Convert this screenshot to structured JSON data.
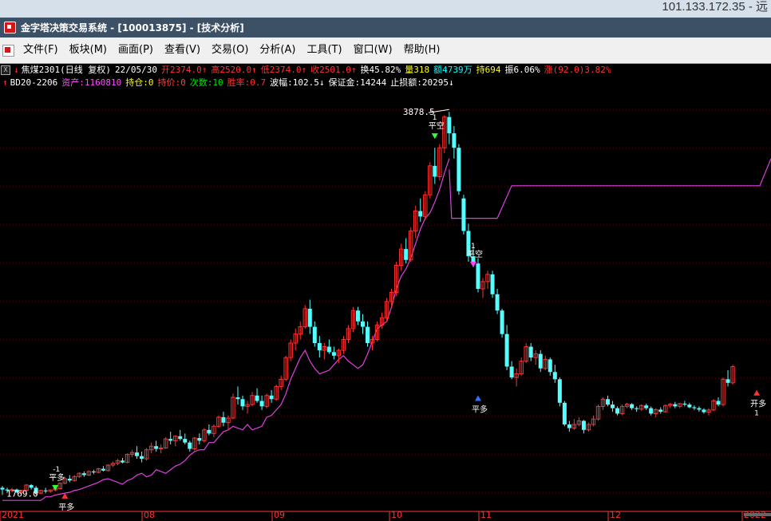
{
  "system": {
    "ip": "101.133.172.35 - 远"
  },
  "title": {
    "text": "金字塔决策交易系统 - [100013875] - [技术分析]"
  },
  "menu": {
    "items": [
      {
        "label": "文件(F)"
      },
      {
        "label": "板块(M)"
      },
      {
        "label": "画面(P)"
      },
      {
        "label": "查看(V)"
      },
      {
        "label": "交易(O)"
      },
      {
        "label": "分析(A)"
      },
      {
        "label": "工具(T)"
      },
      {
        "label": "窗口(W)"
      },
      {
        "label": "帮助(H)"
      }
    ]
  },
  "quote": {
    "symbol": "焦煤2301(日线 复权)",
    "date": "22/05/30",
    "open": "开2374.0",
    "high": "高2520.0",
    "low": "低2374.0",
    "close": "收2501.0",
    "turnover": "换45.82%",
    "volume": "量318",
    "amount": "额4739万",
    "oi": "持694",
    "amplitude": "振6.06%",
    "change": "涨(92.0)3.82%"
  },
  "strategy": {
    "name": "BD20-2206",
    "assets": "资产:1160810",
    "position": "持仓:0",
    "avg_price": "持价:0",
    "trades": "次数:10",
    "win_rate": "胜率:0.7",
    "swing": "波幅:102.5",
    "margin": "保证金:14244",
    "stop": "止损额:20295"
  },
  "annotations": {
    "high_label": "3878.5",
    "low_label": "1769.0"
  },
  "signals": [
    {
      "label": "平多",
      "sub": "-1"
    },
    {
      "label": "平多",
      "sub": ""
    },
    {
      "label": "平空",
      "sub": "1"
    },
    {
      "label": "开多",
      "sub": "1"
    },
    {
      "label": "平空",
      "sub": "1"
    },
    {
      "label": "平多",
      "sub": ""
    }
  ],
  "chart_data": {
    "type": "candlestick",
    "x_ticks": [
      "2021",
      "08",
      "09",
      "10",
      "11",
      "12",
      "2022"
    ],
    "candles": [
      [
        1800,
        1810,
        1760,
        1790
      ],
      [
        1790,
        1800,
        1770,
        1785
      ],
      [
        1785,
        1800,
        1775,
        1790
      ],
      [
        1790,
        1795,
        1770,
        1775
      ],
      [
        1775,
        1790,
        1765,
        1785
      ],
      [
        1785,
        1820,
        1780,
        1815
      ],
      [
        1815,
        1820,
        1790,
        1800
      ],
      [
        1800,
        1810,
        1760,
        1770
      ],
      [
        1770,
        1790,
        1765,
        1785
      ],
      [
        1785,
        1800,
        1770,
        1780
      ],
      [
        1780,
        1790,
        1772,
        1788
      ],
      [
        1788,
        1800,
        1780,
        1795
      ],
      [
        1795,
        1830,
        1790,
        1825
      ],
      [
        1825,
        1860,
        1820,
        1850
      ],
      [
        1850,
        1870,
        1830,
        1840
      ],
      [
        1840,
        1870,
        1835,
        1862
      ],
      [
        1862,
        1885,
        1855,
        1880
      ],
      [
        1880,
        1890,
        1860,
        1870
      ],
      [
        1870,
        1895,
        1865,
        1890
      ],
      [
        1890,
        1900,
        1875,
        1885
      ],
      [
        1885,
        1910,
        1880,
        1905
      ],
      [
        1905,
        1920,
        1890,
        1895
      ],
      [
        1895,
        1930,
        1890,
        1925
      ],
      [
        1925,
        1945,
        1915,
        1935
      ],
      [
        1935,
        1960,
        1925,
        1950
      ],
      [
        1950,
        1965,
        1935,
        1940
      ],
      [
        1940,
        1990,
        1935,
        1985
      ],
      [
        1985,
        2010,
        1970,
        1995
      ],
      [
        1995,
        2030,
        1960,
        1975
      ],
      [
        1975,
        2000,
        1940,
        1960
      ],
      [
        1960,
        2020,
        1950,
        2010
      ],
      [
        2010,
        2050,
        1990,
        2030
      ],
      [
        2030,
        2060,
        2000,
        2015
      ],
      [
        2015,
        2040,
        1990,
        2020
      ],
      [
        2020,
        2080,
        2015,
        2070
      ],
      [
        2070,
        2110,
        2040,
        2060
      ],
      [
        2060,
        2090,
        2030,
        2085
      ],
      [
        2085,
        2120,
        2060,
        2070
      ],
      [
        2070,
        2100,
        2040,
        2050
      ],
      [
        2050,
        2060,
        2000,
        2015
      ],
      [
        2015,
        2080,
        2005,
        2075
      ],
      [
        2075,
        2100,
        2040,
        2060
      ],
      [
        2060,
        2130,
        2050,
        2120
      ],
      [
        2120,
        2150,
        2090,
        2100
      ],
      [
        2100,
        2150,
        2080,
        2140
      ],
      [
        2140,
        2200,
        2130,
        2190
      ],
      [
        2190,
        2220,
        2140,
        2160
      ],
      [
        2160,
        2200,
        2120,
        2185
      ],
      [
        2185,
        2320,
        2180,
        2300
      ],
      [
        2300,
        2360,
        2260,
        2290
      ],
      [
        2290,
        2310,
        2230,
        2250
      ],
      [
        2250,
        2280,
        2210,
        2260
      ],
      [
        2260,
        2330,
        2250,
        2310
      ],
      [
        2310,
        2350,
        2270,
        2280
      ],
      [
        2280,
        2310,
        2230,
        2250
      ],
      [
        2250,
        2320,
        2240,
        2310
      ],
      [
        2310,
        2340,
        2270,
        2290
      ],
      [
        2290,
        2370,
        2280,
        2360
      ],
      [
        2360,
        2420,
        2340,
        2400
      ],
      [
        2400,
        2530,
        2390,
        2520
      ],
      [
        2520,
        2620,
        2500,
        2600
      ],
      [
        2600,
        2680,
        2560,
        2650
      ],
      [
        2650,
        2720,
        2620,
        2690
      ],
      [
        2690,
        2810,
        2680,
        2790
      ],
      [
        2790,
        2840,
        2650,
        2690
      ],
      [
        2690,
        2720,
        2580,
        2600
      ],
      [
        2600,
        2640,
        2520,
        2560
      ],
      [
        2560,
        2600,
        2510,
        2580
      ],
      [
        2580,
        2620,
        2540,
        2550
      ],
      [
        2550,
        2580,
        2510,
        2530
      ],
      [
        2530,
        2570,
        2490,
        2560
      ],
      [
        2560,
        2640,
        2540,
        2620
      ],
      [
        2620,
        2700,
        2600,
        2680
      ],
      [
        2680,
        2800,
        2660,
        2780
      ],
      [
        2780,
        2800,
        2700,
        2720
      ],
      [
        2720,
        2760,
        2650,
        2690
      ],
      [
        2690,
        2720,
        2580,
        2600
      ],
      [
        2600,
        2640,
        2560,
        2620
      ],
      [
        2620,
        2720,
        2610,
        2700
      ],
      [
        2700,
        2770,
        2680,
        2740
      ],
      [
        2740,
        2850,
        2720,
        2830
      ],
      [
        2830,
        2900,
        2800,
        2880
      ],
      [
        2880,
        3050,
        2860,
        3030
      ],
      [
        3030,
        3150,
        3000,
        3120
      ],
      [
        3120,
        3180,
        3040,
        3060
      ],
      [
        3060,
        3240,
        3050,
        3220
      ],
      [
        3220,
        3360,
        3180,
        3330
      ],
      [
        3330,
        3400,
        3270,
        3300
      ],
      [
        3300,
        3440,
        3280,
        3420
      ],
      [
        3420,
        3600,
        3400,
        3580
      ],
      [
        3580,
        3680,
        3480,
        3520
      ],
      [
        3520,
        3700,
        3500,
        3680
      ],
      [
        3680,
        3860,
        3650,
        3850
      ],
      [
        3850,
        3878.5,
        3700,
        3760
      ],
      [
        3760,
        3800,
        3620,
        3680
      ],
      [
        3680,
        3700,
        3420,
        3440
      ],
      [
        3400,
        3420,
        3200,
        3220
      ],
      [
        3220,
        3260,
        3050,
        3080
      ],
      [
        3080,
        3150,
        3020,
        3040
      ],
      [
        3040,
        3070,
        2880,
        2900
      ],
      [
        2900,
        2960,
        2850,
        2940
      ],
      [
        2940,
        3000,
        2900,
        2980
      ],
      [
        2980,
        3000,
        2850,
        2870
      ],
      [
        2870,
        2900,
        2760,
        2780
      ],
      [
        2780,
        2790,
        2630,
        2650
      ],
      [
        2650,
        2700,
        2450,
        2470
      ],
      [
        2470,
        2500,
        2400,
        2410
      ],
      [
        2410,
        2460,
        2360,
        2430
      ],
      [
        2430,
        2520,
        2420,
        2500
      ],
      [
        2500,
        2600,
        2490,
        2580
      ],
      [
        2580,
        2600,
        2500,
        2520
      ],
      [
        2520,
        2560,
        2480,
        2540
      ],
      [
        2540,
        2560,
        2440,
        2460
      ],
      [
        2460,
        2530,
        2450,
        2510
      ],
      [
        2510,
        2520,
        2420,
        2440
      ],
      [
        2440,
        2480,
        2380,
        2400
      ],
      [
        2400,
        2410,
        2250,
        2270
      ],
      [
        2270,
        2280,
        2140,
        2150
      ],
      [
        2150,
        2170,
        2110,
        2130
      ],
      [
        2130,
        2180,
        2120,
        2150
      ],
      [
        2150,
        2190,
        2140,
        2170
      ],
      [
        2170,
        2175,
        2100,
        2120
      ],
      [
        2120,
        2160,
        2110,
        2150
      ],
      [
        2150,
        2200,
        2140,
        2180
      ],
      [
        2180,
        2260,
        2170,
        2250
      ],
      [
        2250,
        2300,
        2230,
        2290
      ],
      [
        2290,
        2310,
        2250,
        2260
      ],
      [
        2260,
        2280,
        2220,
        2240
      ],
      [
        2240,
        2250,
        2200,
        2210
      ],
      [
        2210,
        2260,
        2200,
        2250
      ],
      [
        2250,
        2270,
        2240,
        2262
      ],
      [
        2262,
        2268,
        2230,
        2240
      ],
      [
        2240,
        2250,
        2220,
        2235
      ],
      [
        2235,
        2260,
        2225,
        2255
      ],
      [
        2255,
        2265,
        2230,
        2240
      ],
      [
        2240,
        2250,
        2200,
        2210
      ],
      [
        2210,
        2240,
        2190,
        2232
      ],
      [
        2232,
        2245,
        2210,
        2220
      ],
      [
        2220,
        2260,
        2215,
        2255
      ],
      [
        2255,
        2270,
        2240,
        2262
      ],
      [
        2262,
        2275,
        2240,
        2250
      ],
      [
        2250,
        2270,
        2240,
        2265
      ],
      [
        2265,
        2280,
        2250,
        2260
      ],
      [
        2260,
        2270,
        2240,
        2245
      ],
      [
        2245,
        2255,
        2230,
        2240
      ],
      [
        2240,
        2250,
        2220,
        2232
      ],
      [
        2232,
        2240,
        2210,
        2218
      ],
      [
        2218,
        2240,
        2200,
        2230
      ],
      [
        2230,
        2290,
        2225,
        2280
      ],
      [
        2280,
        2300,
        2250,
        2260
      ],
      [
        2260,
        2410,
        2250,
        2400
      ],
      [
        2400,
        2450,
        2360,
        2380
      ],
      [
        2380,
        2480,
        2370,
        2470
      ]
    ],
    "stop_line": [
      1730,
      1730,
      1730,
      1730,
      1730,
      1730,
      1730,
      1730,
      1730,
      1750,
      1750,
      1760,
      1765,
      1770,
      1775,
      1785,
      1790,
      1800,
      1810,
      1820,
      1830,
      1845,
      1850,
      1840,
      1830,
      1820,
      1840,
      1850,
      1870,
      1880,
      1860,
      1870,
      1900,
      1890,
      1880,
      1900,
      1920,
      1930,
      1950,
      1980,
      2000,
      2010,
      2010,
      2050,
      2050,
      2080,
      2110,
      2120,
      2140,
      2130,
      2120,
      2150,
      2120,
      2130,
      2140,
      2190,
      2200,
      2230,
      2260,
      2320,
      2400,
      2460,
      2520,
      2560,
      2500,
      2460,
      2430,
      2440,
      2450,
      2480,
      2510,
      2530,
      2500,
      2480,
      2460,
      2480,
      2540,
      2610,
      2680,
      2700,
      2720,
      2800,
      2900,
      2970,
      3010,
      3070,
      3150,
      3230,
      3290,
      3320,
      3380,
      3450,
      3540,
      3620
    ],
    "short_line": {
      "from": 93,
      "to": 103,
      "value": 3290
    },
    "long_line": {
      "from": 106,
      "to": 157,
      "value": 3470
    },
    "ylim": [
      1700,
      3950
    ]
  }
}
